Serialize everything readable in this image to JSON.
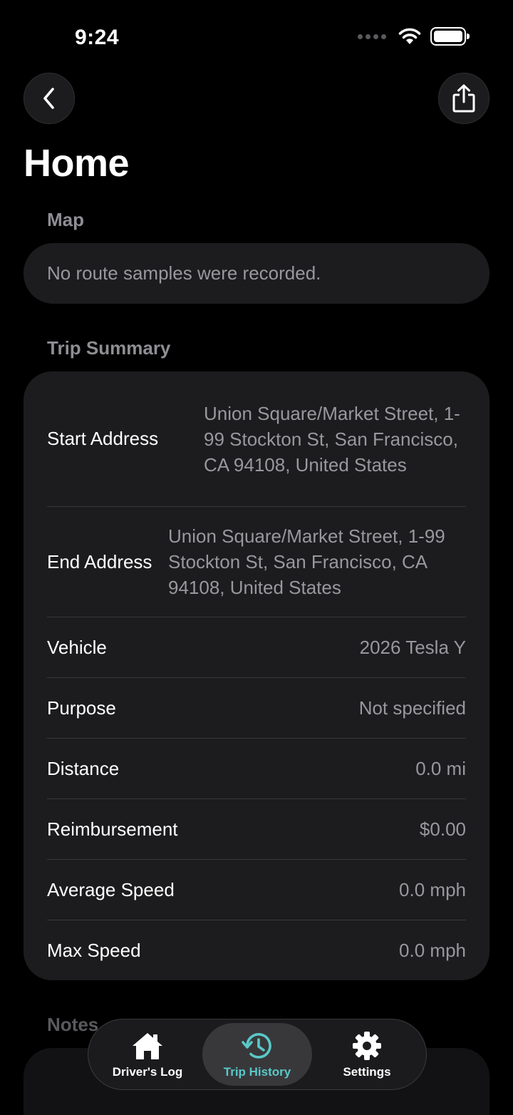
{
  "status_bar": {
    "time": "9:24"
  },
  "header": {
    "title": "Home"
  },
  "map_section": {
    "label": "Map",
    "empty_message": "No route samples were recorded."
  },
  "summary_section": {
    "label": "Trip Summary",
    "rows": [
      {
        "label": "Start Address",
        "value": "Union Square/Market Street, 1-99 Stockton St, San Francisco, CA  94108, United States"
      },
      {
        "label": "End Address",
        "value": "Union Square/Market Street, 1-99 Stockton St, San Francisco, CA 94108, United States"
      },
      {
        "label": "Vehicle",
        "value": "2026 Tesla Y"
      },
      {
        "label": "Purpose",
        "value": "Not specified"
      },
      {
        "label": "Distance",
        "value": "0.0 mi"
      },
      {
        "label": "Reimbursement",
        "value": "$0.00"
      },
      {
        "label": "Average Speed",
        "value": "0.0 mph"
      },
      {
        "label": "Max Speed",
        "value": "0.0 mph"
      }
    ]
  },
  "notes_section": {
    "label": "Notes"
  },
  "tab_bar": {
    "tabs": [
      {
        "label": "Driver's Log",
        "icon": "house-icon",
        "active": false
      },
      {
        "label": "Trip History",
        "icon": "history-icon",
        "active": true
      },
      {
        "label": "Settings",
        "icon": "gear-icon",
        "active": false
      }
    ]
  },
  "colors": {
    "background": "#000000",
    "card": "#1c1c1e",
    "secondary_text": "#98989d",
    "accent": "#5ac8c8"
  }
}
